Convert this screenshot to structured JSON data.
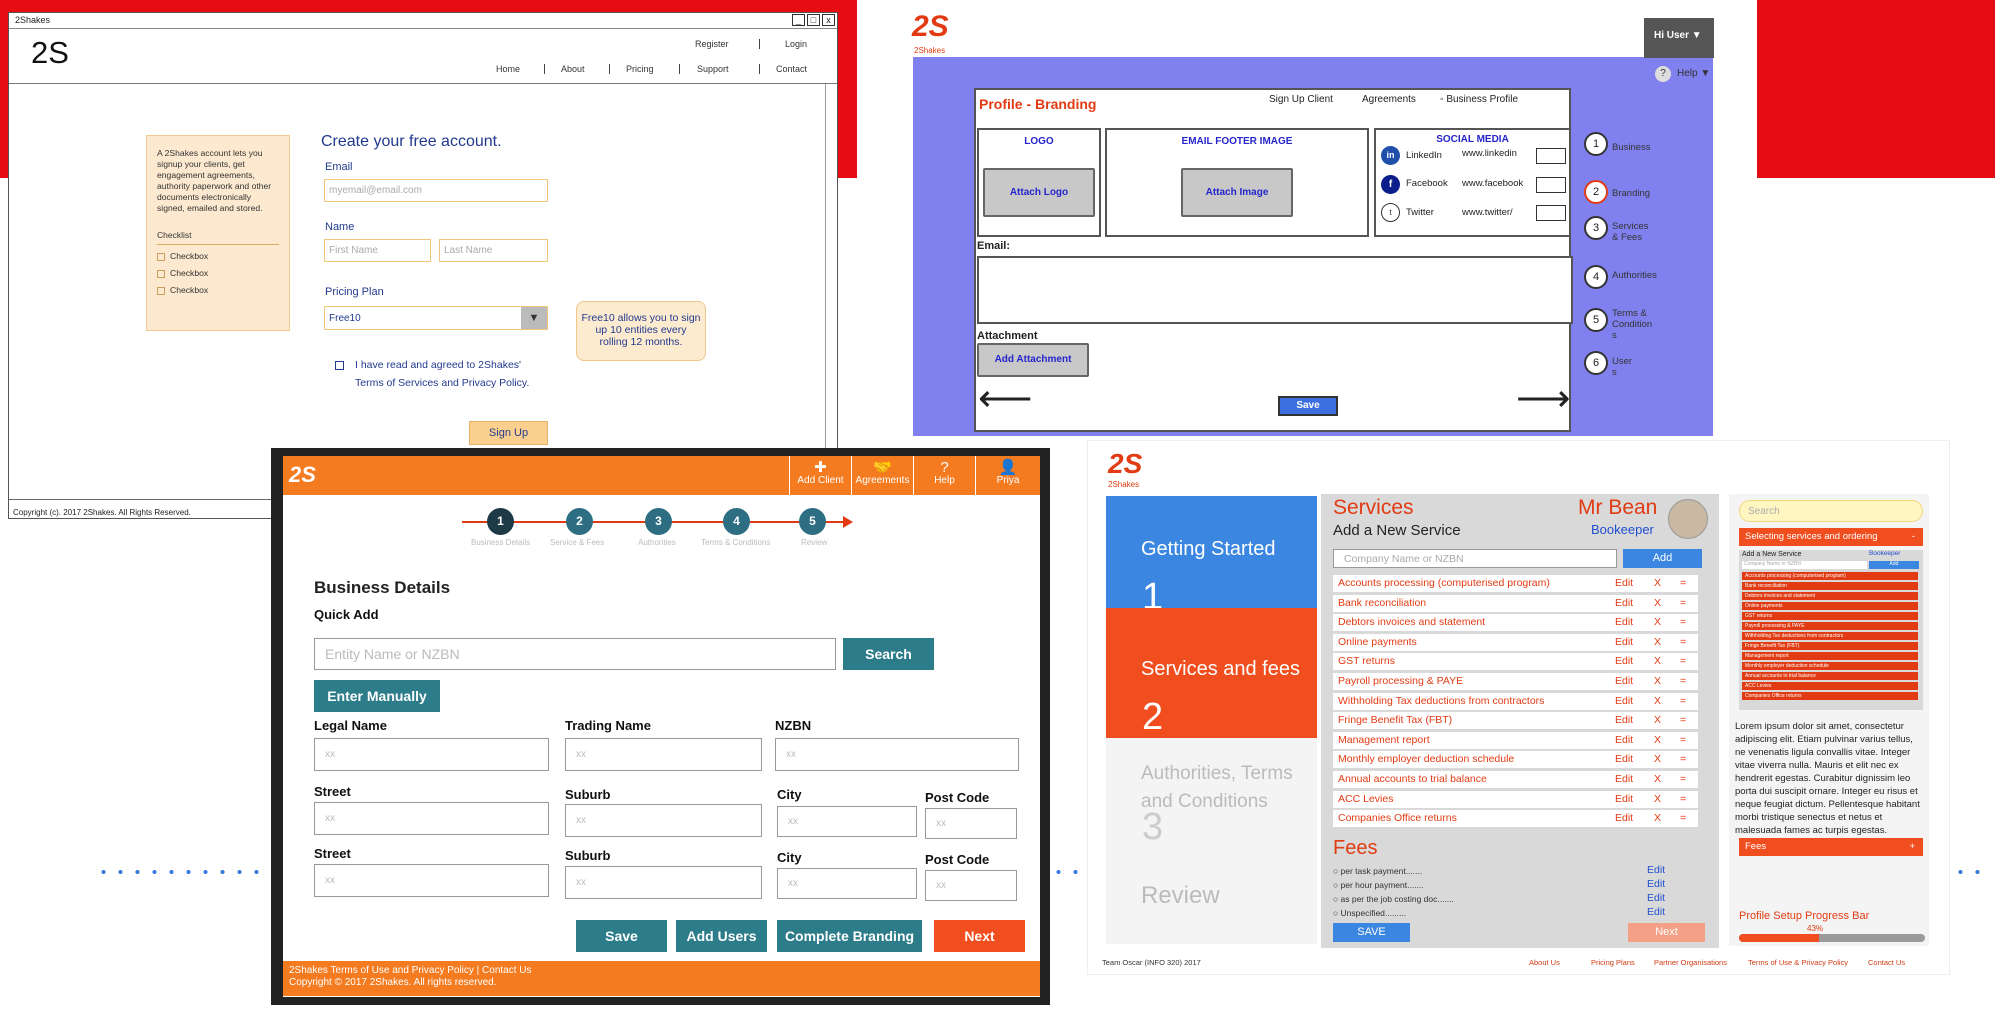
{
  "colors": {
    "red_band": "#e60d12",
    "orange": "#f47b20",
    "teal": "#2d7c8a",
    "purple": "#8080ee",
    "red_accent": "#e23b13"
  },
  "winA": {
    "title": "2Shakes",
    "controls": [
      "_",
      "□",
      "x"
    ],
    "logo": "2S",
    "top_links": [
      "Register",
      "Login"
    ],
    "nav": [
      "Home",
      "About",
      "Pricing",
      "Support",
      "Contact"
    ],
    "info_text": "A 2Shakes account lets you signup your clients, get engagement agreements, authority paperwork and other documents electronically signed, emailed and stored.",
    "checklist_title": "Checklist",
    "checkboxes": [
      "Checkbox",
      "Checkbox",
      "Checkbox"
    ],
    "heading": "Create your free account.",
    "email_label": "Email",
    "email_placeholder": "myemail@email.com",
    "name_label": "Name",
    "first_name_placeholder": "First Name",
    "last_name_placeholder": "Last Name",
    "plan_label": "Pricing Plan",
    "plan_value": "Free10",
    "plan_arrow": "▼",
    "tooltip": "Free10 allows you to sign up 10 entities every rolling 12 months.",
    "agree_line1": "I have read and agreed to 2Shakes'",
    "agree_line2": "Terms of Services and Privacy Policy.",
    "signup": "Sign Up",
    "copyright": "Copyright (c). 2017 2Shakes. All Rights Reserved."
  },
  "winB": {
    "logo": "2S",
    "logo_sub": "2Shakes",
    "user": "Hi User ▼",
    "help": "Help ▼",
    "help_icon": "?",
    "title": "Profile - Branding",
    "tabs": [
      "Sign Up Client",
      "Agreements",
      "Business Profile"
    ],
    "logo_box": "LOGO",
    "attach_logo": "Attach Logo",
    "footer_box": "EMAIL FOOTER IMAGE",
    "attach_image": "Attach Image",
    "social_title": "SOCIAL MEDIA",
    "social": [
      {
        "icon": "in",
        "name": "LinkedIn",
        "url": "www.linkedin"
      },
      {
        "icon": "f",
        "name": "Facebook",
        "url": "www.facebook"
      },
      {
        "icon": "t",
        "name": "Twitter",
        "url": "www.twitter/"
      }
    ],
    "email_label": "Email:",
    "attachment_label": "Attachment",
    "add_attachment": "Add Attachment",
    "save": "Save",
    "steps": [
      {
        "n": "1",
        "l1": "Business",
        "l2": ""
      },
      {
        "n": "2",
        "l1": "Branding",
        "l2": ""
      },
      {
        "n": "3",
        "l1": "Services",
        "l2": "& Fees"
      },
      {
        "n": "4",
        "l1": "Authorities",
        "l2": ""
      },
      {
        "n": "5",
        "l1": "Terms &",
        "l2": "Condition s"
      },
      {
        "n": "6",
        "l1": "User",
        "l2": "s"
      }
    ]
  },
  "winC": {
    "logo": "2S",
    "header_buttons": [
      {
        "icon": "✚",
        "label": "Add Client"
      },
      {
        "icon": "🤝",
        "label": "Agreements"
      },
      {
        "icon": "?",
        "label": "Help"
      },
      {
        "icon": "👤",
        "label": "Priya"
      }
    ],
    "progress": [
      {
        "n": "1",
        "label": "Business Details"
      },
      {
        "n": "2",
        "label": "Service & Fees"
      },
      {
        "n": "3",
        "label": "Authorities"
      },
      {
        "n": "4",
        "label": "Terms & Conditions"
      },
      {
        "n": "5",
        "label": "Review"
      }
    ],
    "heading": "Business Details",
    "quick_add": "Quick Add",
    "search_placeholder": "Entity Name or NZBN",
    "search": "Search",
    "enter_manually": "Enter Manually",
    "legal": "Legal Name",
    "trading": "Trading Name",
    "nzbn": "NZBN",
    "street": "Street",
    "suburb": "Suburb",
    "city": "City",
    "postcode": "Post Code",
    "xx": "xx",
    "save": "Save",
    "add_users": "Add Users",
    "complete_branding": "Complete Branding",
    "next": "Next",
    "footer1": "2Shakes Terms of Use and Privacy Policy | Contact Us",
    "footer2": "Copyright © 2017 2Shakes. All rights reserved."
  },
  "winD": {
    "logo": "2S",
    "logo_sub": "2Shakes",
    "side": [
      {
        "label": "Getting Started",
        "n": "1"
      },
      {
        "label": "Services and fees",
        "n": "2"
      },
      {
        "label": "Authorities, Terms and Conditions",
        "n": "3"
      },
      {
        "label": "Review",
        "n": ""
      }
    ],
    "title": "Services",
    "subtitle": "Add a New Service",
    "user": "Mr Bean",
    "role": "Bookeeper",
    "input_placeholder": "Company Name or NZBN",
    "add": "Add",
    "edit": "Edit",
    "x": "X",
    "eq": "=",
    "services": [
      "Accounts processing (computerised program)",
      "Bank reconciliation",
      "Debtors invoices and statement",
      "Online payments",
      "GST returns",
      "Payroll processing & PAYE",
      "Withholding Tax deductions from contractors",
      "Fringe Benefit Tax (FBT)",
      "Management report",
      "Monthly employer deduction schedule",
      "Annual accounts to trial balance",
      "ACC Levies",
      "Companies Office returns"
    ],
    "fees_title": "Fees",
    "fees": [
      "per task payment.......",
      "per hour payment.......",
      "as per the job costing doc.......",
      "Unspecified........."
    ],
    "save": "SAVE",
    "next": "Next",
    "search": "Search",
    "panel_title": "Selecting services and ordering",
    "panel_minus": "-",
    "mini_head": "Add a New Service",
    "mini_user": "Bookeeper",
    "mini_input": "Company Name or NZBN",
    "mini_add": "Add",
    "lorem": "Lorem ipsum dolor sit amet, consectetur adipiscing elit. Etiam pulvinar varius tellus, ne venenatis ligula convallis vitae. Integer vitae viverra nulla. Mauris et elit nec ex hendrerit egestas. Curabitur dignissim leo porta dui suscipit ornare. Integer eu risus et neque feugiat dictum. Pellentesque habitant morbi tristique senectus et netus et malesuada fames ac turpis egestas.",
    "fees_bar": "Fees",
    "fees_plus": "+",
    "progress_title": "Profile Setup Progress Bar",
    "progress_pct": "43%",
    "progress_value": 0.43,
    "footer": [
      "Team Oscar (INFO 320) 2017",
      "About Us",
      "Pricing Plans",
      "Partner Organisations",
      "Terms of Use & Privacy Policy",
      "Contact Us"
    ]
  }
}
